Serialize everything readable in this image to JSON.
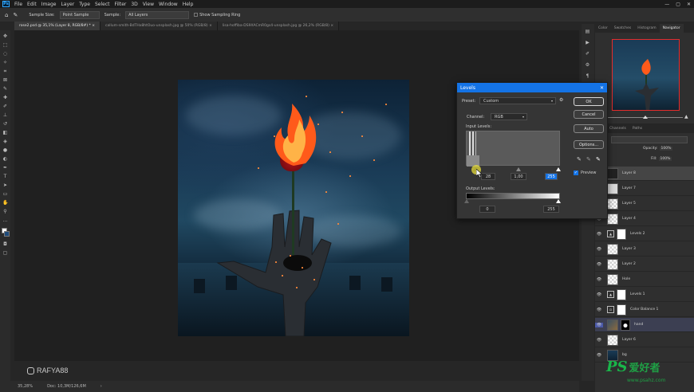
{
  "menu": {
    "logo": "Ps",
    "items": [
      "File",
      "Edit",
      "Image",
      "Layer",
      "Type",
      "Select",
      "Filter",
      "3D",
      "View",
      "Window",
      "Help"
    ],
    "window_controls": [
      "—",
      "▢",
      "✕"
    ]
  },
  "options_bar": {
    "sample_size_label": "Sample Size:",
    "sample_size_value": "Point Sample",
    "sample_label": "Sample:",
    "sample_value": "All Layers",
    "show_ring_label": "Show Sampling Ring"
  },
  "tabs": [
    "rose2.psd @ 35,1% (Layer 8, RGB/8#) *",
    "callum-smith-BdTHx8htOuo-unsplash.jpg @ 50% (RGB/8)",
    "lisa-hoffiba-DS9XACmR0gs4-unsplash.jpg @ 26,2% (RGB/8)"
  ],
  "status": {
    "zoom": "35,28%",
    "doc": "Doc: 10,3M/126,6M"
  },
  "watermark": {
    "handle": "RAFYA88",
    "ps_brand": "PS",
    "ps_cn": "爱好者",
    "site": "www.psahz.com"
  },
  "panels": {
    "tabs": [
      "Color",
      "Swatches",
      "Histogram",
      "Navigator"
    ],
    "active_tab": "Navigator",
    "layer_tabs": [
      "Channels",
      "Paths"
    ],
    "opacity_label": "Opacity:",
    "fill_label": "Fill:",
    "opacity_value": "100%",
    "fill_value": "100%"
  },
  "layers": [
    {
      "name": "Layer 8",
      "thumb": "dark",
      "selected": true
    },
    {
      "name": "Layer 7",
      "thumb": "white"
    },
    {
      "name": "Layer 5",
      "thumb": "checker"
    },
    {
      "name": "Layer 4",
      "thumb": "checker"
    },
    {
      "name": "Levels 2",
      "thumb": "adj",
      "mask": "white"
    },
    {
      "name": "Layer 3",
      "thumb": "checker"
    },
    {
      "name": "Layer 2",
      "thumb": "checker"
    },
    {
      "name": "Hole",
      "thumb": "checker"
    },
    {
      "name": "Levels 1",
      "thumb": "adj",
      "mask": "white"
    },
    {
      "name": "Color Balance 1",
      "thumb": "adj",
      "mask": "white"
    },
    {
      "name": "hand",
      "thumb": "photo",
      "mask": "black",
      "active": true
    },
    {
      "name": "Layer 6",
      "thumb": "checker"
    },
    {
      "name": "bg",
      "thumb": "bgimg"
    }
  ],
  "levels": {
    "title": "Levels",
    "preset_label": "Preset:",
    "preset_value": "Custom",
    "channel_label": "Channel:",
    "channel_value": "RGB",
    "input_label": "Input Levels:",
    "output_label": "Output Levels:",
    "input_black": "28",
    "input_gamma": "1,00",
    "input_white": "255",
    "output_black": "0",
    "output_white": "255",
    "ok": "OK",
    "cancel": "Cancel",
    "auto": "Auto",
    "options": "Options...",
    "preview_label": "Preview",
    "preview_checked": true,
    "close": "✕"
  }
}
